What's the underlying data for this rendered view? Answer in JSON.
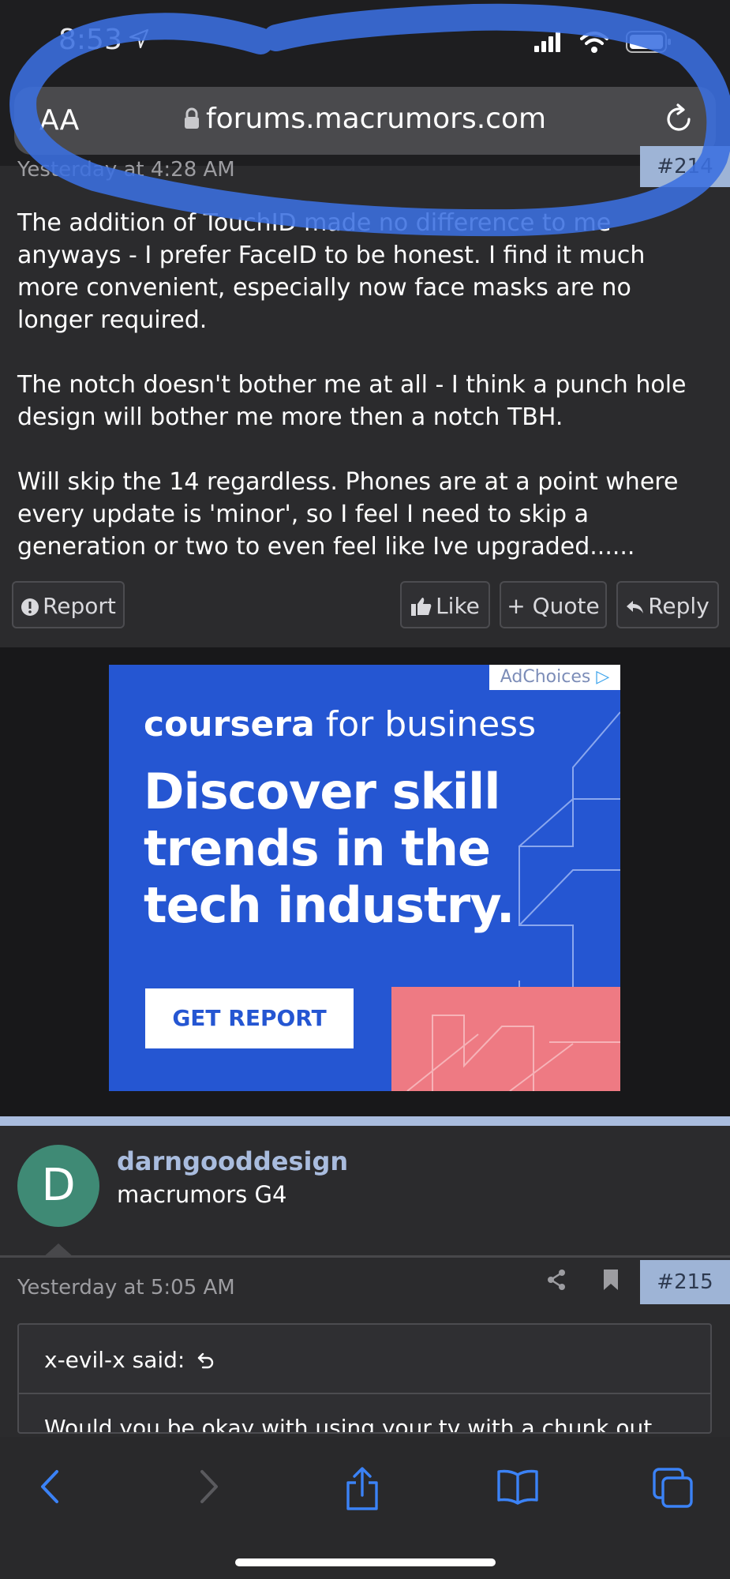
{
  "status_bar": {
    "time": "8:53"
  },
  "address_bar": {
    "text_size_label": "AA",
    "url": "forums.macrumors.com"
  },
  "post_214": {
    "timestamp": "Yesterday at 4:28 AM",
    "number": "#214",
    "paragraphs": [
      "The addition of TouchID made no difference to me anyways - I prefer FaceID to be honest. I find it much more convenient, especially now face masks are no longer required.",
      "The notch doesn't bother me at all - I think a punch hole design will bother me more then a notch TBH.",
      "Will skip the 14 regardless. Phones are at a point where every update is 'minor', so I feel I need to skip a generation or two to even feel like Ive upgraded......"
    ],
    "actions": {
      "report": "Report",
      "like": "Like",
      "quote": "+ Quote",
      "reply": "Reply"
    }
  },
  "ad": {
    "adchoices": "AdChoices",
    "brand": "coursera",
    "brand_suffix": "for business",
    "headline_lines": [
      "Discover skill",
      "trends in the",
      "tech industry."
    ],
    "cta": "GET REPORT"
  },
  "post_215": {
    "author": "darngooddesign",
    "author_title": "macrumors G4",
    "avatar_letter": "D",
    "timestamp": "Yesterday at 5:05 AM",
    "number": "#215",
    "quote": {
      "author": "x-evil-x said:",
      "text": "Would you be okay with using your tv with a chunk out"
    }
  },
  "colors": {
    "page_bg": "#2b2b2d",
    "accent": "#9eb4d6",
    "ad_blue": "#2556d2",
    "scribble": "#3b6fe0",
    "avatar": "#3f8a75"
  }
}
